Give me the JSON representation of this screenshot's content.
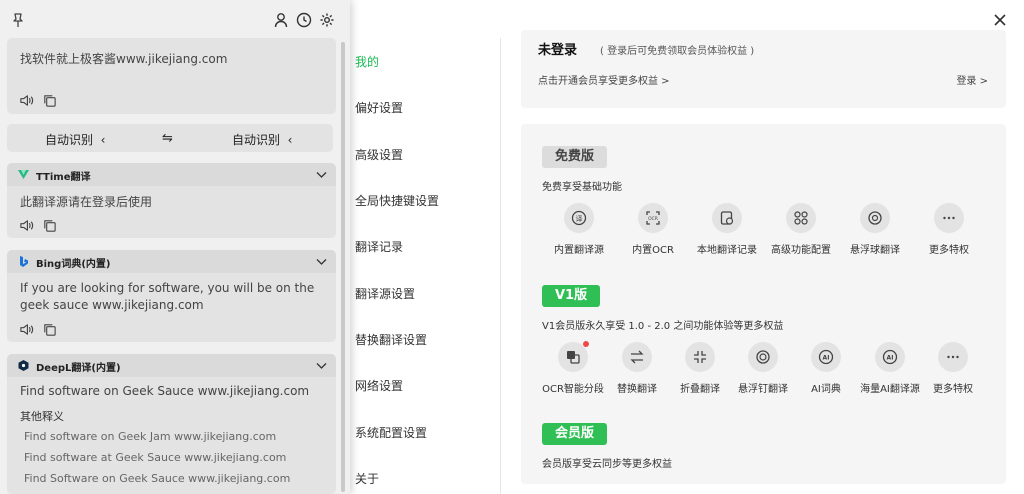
{
  "popup": {
    "source_text": "找软件就上极客酱www.jikejiang.com",
    "lang": {
      "from": "自动识别",
      "swap": "⇋",
      "to": "自动识别"
    },
    "engines": [
      {
        "name": "TTime翻译",
        "body": "此翻译源请在登录后使用"
      },
      {
        "name": "Bing词典(内置)",
        "body": "If you are looking for software, you will be on the geek sauce www.jikejiang.com"
      },
      {
        "name": "DeepL翻译(内置)",
        "body": "Find software on Geek Sauce www.jikejiang.com",
        "other_label": "其他释义",
        "alternatives": [
          "Find software on Geek Jam www.jikejiang.com",
          "Find software at Geek Sauce www.jikejiang.com",
          "Find Software on Geek Sauce www.jikejiang.com"
        ]
      }
    ]
  },
  "settings": {
    "nav": [
      "我的",
      "偏好设置",
      "高级设置",
      "全局快捷键设置",
      "翻译记录",
      "翻译源设置",
      "替换翻译设置",
      "网络设置",
      "系统配置设置",
      "关于"
    ],
    "accent": "#19b955",
    "login": {
      "title": "未登录",
      "subtitle": "( 登录后可免费领取会员体验权益 )",
      "link": "点击开通会员享受更多权益 >",
      "button": "登录 >"
    },
    "free": {
      "badge": "免费版",
      "desc": "免费享受基础功能",
      "features": [
        "内置翻译源",
        "内置OCR",
        "本地翻译记录",
        "高级功能配置",
        "悬浮球翻译",
        "更多特权"
      ]
    },
    "v1": {
      "badge": "V1版",
      "desc": "V1会员版永久享受 1.0 - 2.0 之间功能体验等更多权益",
      "features": [
        "OCR智能分段",
        "替换翻译",
        "折叠翻译",
        "悬浮钉翻译",
        "AI词典",
        "海量AI翻译源",
        "更多特权"
      ]
    },
    "member": {
      "badge": "会员版",
      "desc": "会员版享受云同步等更多权益"
    }
  }
}
